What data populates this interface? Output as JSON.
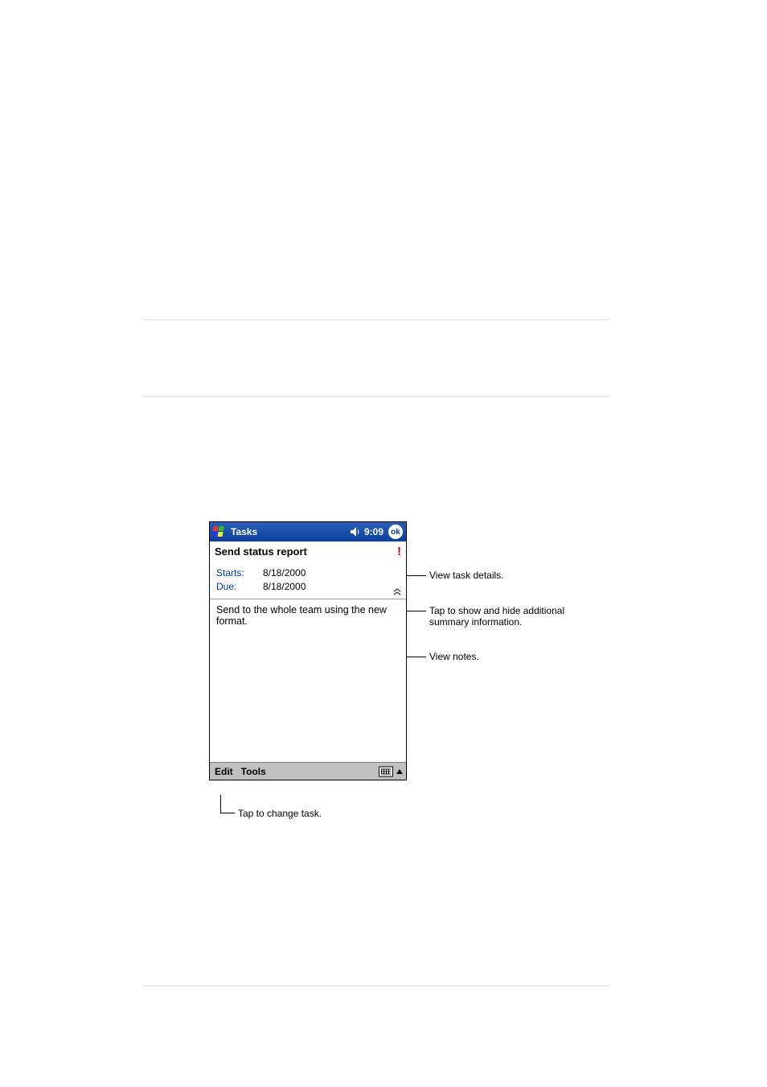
{
  "titlebar": {
    "app_name": "Tasks",
    "time": "9:09",
    "ok_label": "ok"
  },
  "task": {
    "subject": "Send status report",
    "starts_label": "Starts:",
    "starts_value": "8/18/2000",
    "due_label": "Due:",
    "due_value": "8/18/2000",
    "notes": "Send to the whole team using the new format."
  },
  "bottombar": {
    "edit": "Edit",
    "tools": "Tools"
  },
  "callouts": {
    "details": "View task details.",
    "toggle": "Tap to show and hide additional summary information.",
    "notes": "View notes.",
    "edit": "Tap to change task."
  }
}
